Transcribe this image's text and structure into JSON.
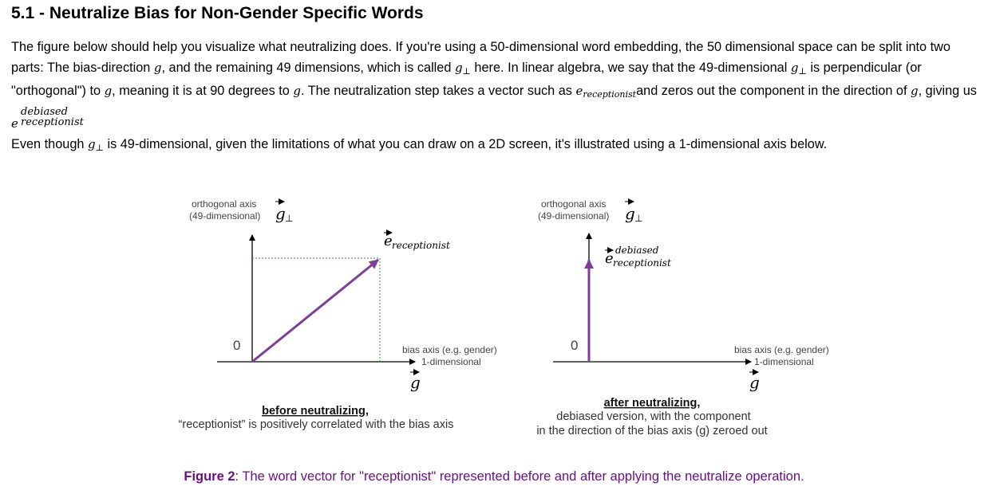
{
  "heading": "5.1 - Neutralize Bias for Non-Gender Specific Words",
  "paragraph1": {
    "t1": "The figure below should help you visualize what neutralizing does. If you're using a 50-dimensional word embedding, the 50 dimensional space can be split into two parts: The bias-direction ",
    "g": "g",
    "t2": ", and the remaining 49 dimensions, which is called ",
    "gperp": "g",
    "perp": "⊥",
    "t3": " here. In linear algebra, we say that the 49-dimensional ",
    "t4": " is perpendicular (or \"orthogonal\") to ",
    "t5": ", meaning it is at 90 degrees to ",
    "t6": ". The neutralization step takes a vector such as ",
    "e": "e",
    "receptionist": "receptionist",
    "t7": "and zeros out the component in the direction of ",
    "t8": ", giving us ",
    "debiased": "debiased"
  },
  "paragraph2": {
    "t1": "Even though ",
    "t2": " is 49-dimensional, given the limitations of what you can draw on a 2D screen, it's illustrated using a 1-dimensional axis below."
  },
  "diagram_left": {
    "ortho_axis_line1": "orthogonal axis",
    "ortho_axis_line2": "(49-dimensional)",
    "vec_g": "g",
    "perp": "⊥",
    "origin": "0",
    "bias_axis_line1": "bias axis (e.g. gender)",
    "bias_axis_line2": "1-dimensional",
    "vec_e": "e",
    "vec_label_sub": "receptionist",
    "caption_title": "before neutralizing,",
    "caption_text": "“receptionist” is positively correlated with the bias axis"
  },
  "diagram_right": {
    "ortho_axis_line1": "orthogonal axis",
    "ortho_axis_line2": "(49-dimensional)",
    "vec_g": "g",
    "perp": "⊥",
    "origin": "0",
    "bias_axis_line1": "bias axis (e.g. gender)",
    "bias_axis_line2": "1-dimensional",
    "vec_e": "e",
    "vec_label_sup": "debiased",
    "vec_label_sub": "receptionist",
    "caption_title": "after neutralizing,",
    "caption_text1": "debiased version, with the component",
    "caption_text2": "in the direction of the bias axis (g) zeroed out"
  },
  "figure_caption": {
    "label": "Figure 2",
    "text": ": The word vector for \"receptionist\" represented before and after applying the neutralize operation."
  },
  "colors": {
    "vector": "#7b3f98",
    "projection": "#2e8b3e",
    "caption": "#6b0f86"
  }
}
